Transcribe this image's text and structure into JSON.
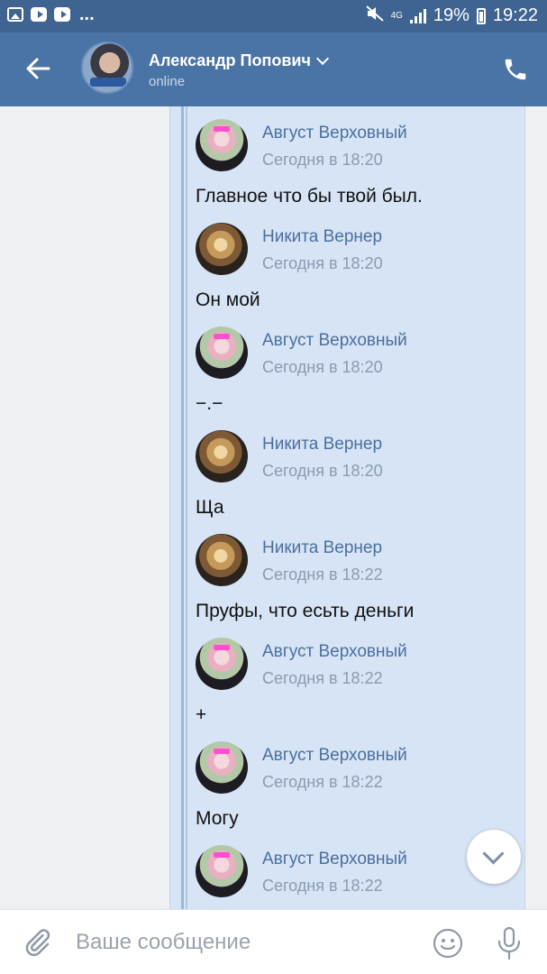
{
  "status_bar": {
    "time": "19:22",
    "battery": "19%",
    "network": "4G",
    "icons": [
      "image-icon",
      "youtube-icon",
      "youtube-icon",
      "more-dots-icon",
      "mute-icon",
      "signal-icon",
      "battery-icon"
    ],
    "more": "..."
  },
  "header": {
    "name": "Александр Попович",
    "status": "online",
    "icons": [
      "back-arrow-icon",
      "chevron-down-icon",
      "phone-icon"
    ]
  },
  "messages": [
    {
      "author": "Август Верховный",
      "time": "Сегодня в 18:20",
      "text": "Главное что бы твой был.",
      "avatar": "anime-avatar"
    },
    {
      "author": "Никита Вернер",
      "time": "Сегодня в 18:20",
      "text": "Он мой",
      "avatar": "cat-avatar"
    },
    {
      "author": "Август Верховный",
      "time": "Сегодня в 18:20",
      "text": "−.−",
      "avatar": "anime-avatar"
    },
    {
      "author": "Никита Вернер",
      "time": "Сегодня в 18:20",
      "text": "Ща",
      "avatar": "cat-avatar"
    },
    {
      "author": "Никита Вернер",
      "time": "Сегодня в 18:22",
      "text": "Пруфы, что есьть деньги",
      "avatar": "cat-avatar"
    },
    {
      "author": "Август Верховный",
      "time": "Сегодня в 18:22",
      "text": "+",
      "avatar": "anime-avatar"
    },
    {
      "author": "Август Верховный",
      "time": "Сегодня в 18:22",
      "text": "Могу",
      "avatar": "anime-avatar"
    },
    {
      "author": "Август Верховный",
      "time": "Сегодня в 18:22",
      "text": "",
      "avatar": "anime-avatar"
    }
  ],
  "input": {
    "placeholder": "Ваше сообщение",
    "icons": [
      "paperclip-icon",
      "emoji-icon",
      "microphone-icon"
    ]
  },
  "colors": {
    "header_bg": "#4a74a5",
    "status_bg": "#3f6491",
    "forward_bg": "#d6e4f6",
    "author_color": "#4b6f9d"
  }
}
